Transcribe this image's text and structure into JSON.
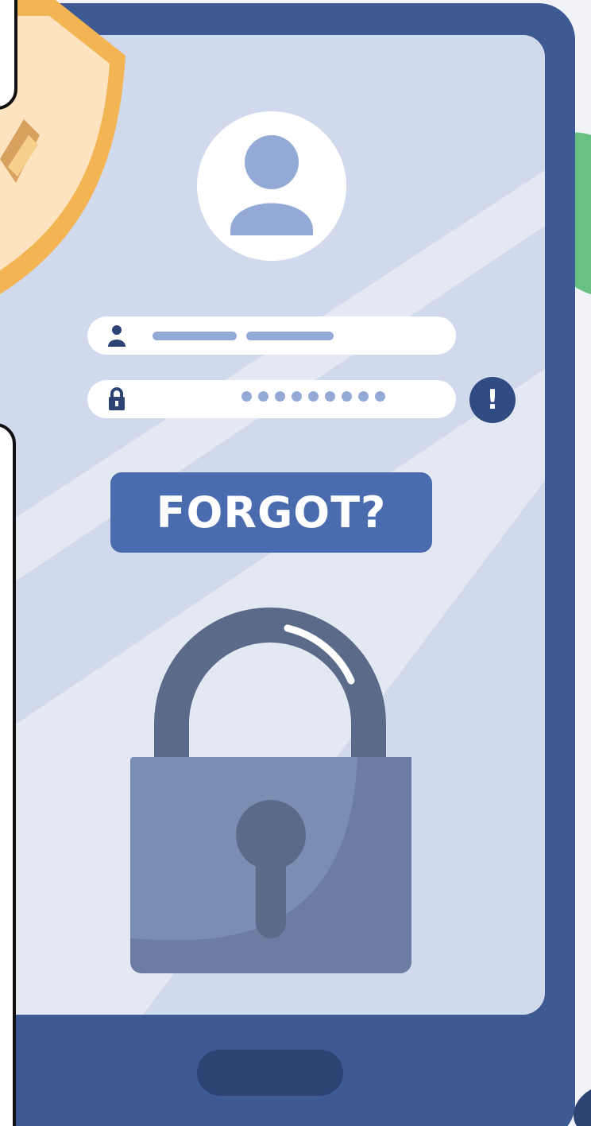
{
  "screen": {
    "forgot_button_label": "FORGOT?",
    "password_dot_count": 9,
    "alert_symbol": "!"
  },
  "icons": {
    "avatar": "user-avatar-icon",
    "username": "user-icon",
    "password": "lock-icon",
    "alert": "exclamation-icon",
    "padlock": "padlock-icon",
    "shield": "shield-icon",
    "leaf": "leaf-icon"
  },
  "colors": {
    "phone_frame": "#3d5a94",
    "screen": "#e3e8f2",
    "button": "#4a6cae",
    "alert": "#304a82",
    "placeholder": "#93aad6",
    "padlock_body": "#7a8db2",
    "padlock_shackle": "#5a6b8a",
    "shield": "#f3b454",
    "leaf": "#68c082"
  }
}
